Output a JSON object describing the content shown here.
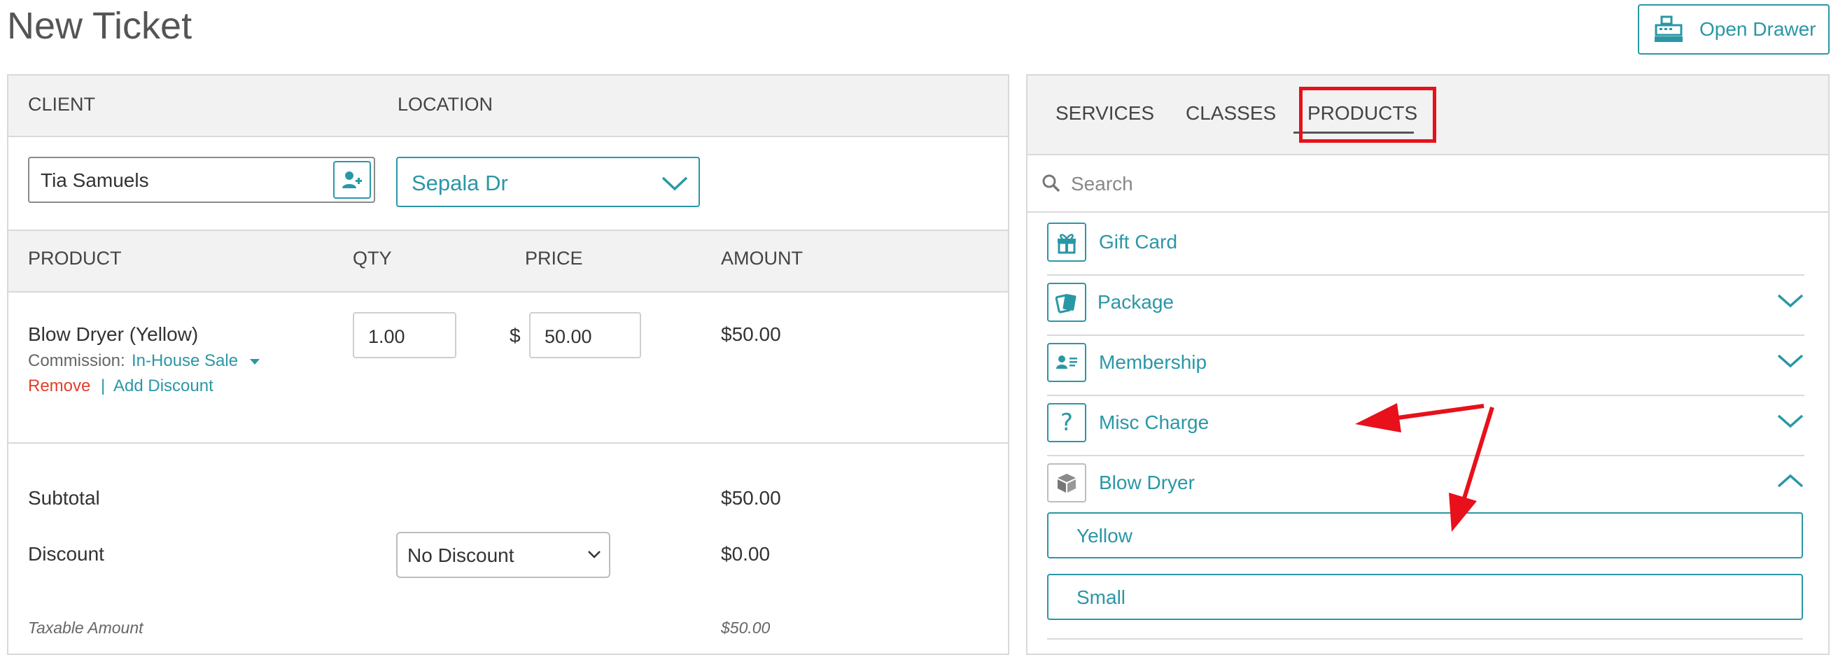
{
  "page": {
    "title": "New Ticket",
    "open_drawer_label": "Open Drawer"
  },
  "ticket": {
    "headers": {
      "client": "CLIENT",
      "location": "LOCATION"
    },
    "client_value": "Tia Samuels",
    "location_value": "Sepala Dr",
    "line_headers": {
      "product": "PRODUCT",
      "qty": "QTY",
      "price": "PRICE",
      "amount": "AMOUNT"
    },
    "line_item": {
      "name": "Blow Dryer (Yellow)",
      "commission_label": "Commission:",
      "commission_value": "In-House Sale",
      "remove_label": "Remove",
      "separator": "|",
      "add_discount_label": "Add Discount",
      "qty": "1.00",
      "currency_symbol": "$",
      "price": "50.00",
      "amount": "$50.00"
    },
    "totals": {
      "subtotal_label": "Subtotal",
      "subtotal_value": "$50.00",
      "discount_label": "Discount",
      "discount_select": "No Discount",
      "discount_value": "$0.00",
      "taxable_label": "Taxable Amount",
      "taxable_value": "$50.00"
    }
  },
  "catalog": {
    "tabs": [
      {
        "label": "SERVICES",
        "active": false
      },
      {
        "label": "CLASSES",
        "active": false
      },
      {
        "label": "PRODUCTS",
        "active": true
      }
    ],
    "search_placeholder": "Search",
    "categories": [
      {
        "label": "Gift Card",
        "icon": "gift-icon",
        "expandable": false
      },
      {
        "label": "Package",
        "icon": "package-icon",
        "expandable": true,
        "expanded": false
      },
      {
        "label": "Membership",
        "icon": "membership-card-icon",
        "expandable": true,
        "expanded": false
      },
      {
        "label": "Misc Charge",
        "icon": "question-mark-icon",
        "expandable": true,
        "expanded": false
      },
      {
        "label": "Blow Dryer",
        "icon": "product-box-icon",
        "expandable": true,
        "expanded": true
      }
    ],
    "variants": [
      "Yellow",
      "Small"
    ]
  },
  "colors": {
    "accent": "#2a97a6",
    "danger": "#e0402a",
    "annotation": "#e8101a",
    "header_bg": "#f2f2f2",
    "border": "#d9d9d9"
  }
}
